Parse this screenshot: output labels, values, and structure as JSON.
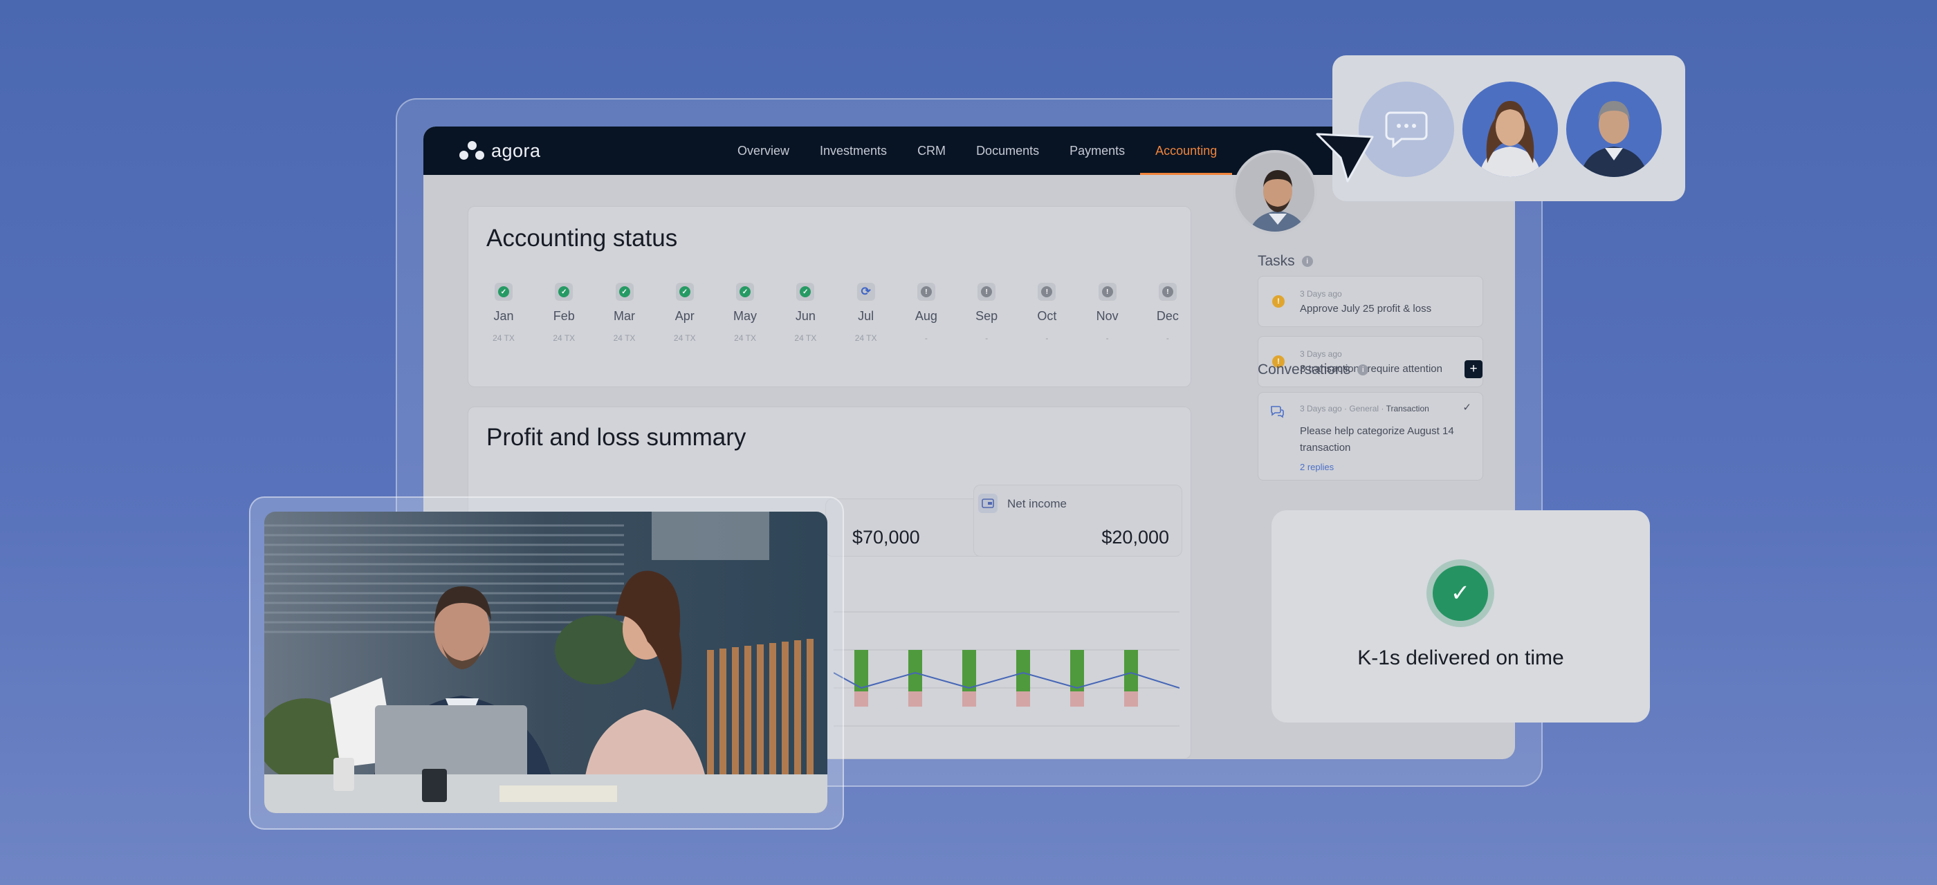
{
  "app": {
    "logo_text": "agora",
    "nav": [
      "Overview",
      "Investments",
      "CRM",
      "Documents",
      "Payments",
      "Accounting"
    ],
    "active_nav": "Accounting"
  },
  "accounting_status": {
    "title": "Accounting status",
    "months": [
      {
        "name": "Jan",
        "sub": "24 TX",
        "status": "done"
      },
      {
        "name": "Feb",
        "sub": "24 TX",
        "status": "done"
      },
      {
        "name": "Mar",
        "sub": "24 TX",
        "status": "done"
      },
      {
        "name": "Apr",
        "sub": "24 TX",
        "status": "done"
      },
      {
        "name": "May",
        "sub": "24 TX",
        "status": "done"
      },
      {
        "name": "Jun",
        "sub": "24 TX",
        "status": "done"
      },
      {
        "name": "Jul",
        "sub": "24 TX",
        "status": "sync"
      },
      {
        "name": "Aug",
        "sub": "-",
        "status": "pending"
      },
      {
        "name": "Sep",
        "sub": "-",
        "status": "pending"
      },
      {
        "name": "Oct",
        "sub": "-",
        "status": "pending"
      },
      {
        "name": "Nov",
        "sub": "-",
        "status": "pending"
      },
      {
        "name": "Dec",
        "sub": "-",
        "status": "pending"
      }
    ]
  },
  "profit_loss": {
    "title": "Profit and loss summary",
    "expenses_amount": "$70,000",
    "net_income_label": "Net income",
    "net_income_amount": "$20,000"
  },
  "tasks": {
    "title": "Tasks",
    "items": [
      {
        "time": "3 Days ago",
        "text": "Approve July 25 profit & loss"
      },
      {
        "time": "3 Days ago",
        "text": "3 transactions require attention"
      }
    ]
  },
  "conversations": {
    "title": "Conversations",
    "meta_time": "3 Days ago",
    "meta_tag1": "General",
    "meta_tag2": "Transaction",
    "message": "Please help categorize  August 14 transaction",
    "replies": "2 replies"
  },
  "k1": {
    "text": "K-1s delivered on time"
  },
  "colors": {
    "accent": "#f0843c",
    "success": "#259462",
    "navbar": "#081424",
    "background": "#4a68b0"
  }
}
